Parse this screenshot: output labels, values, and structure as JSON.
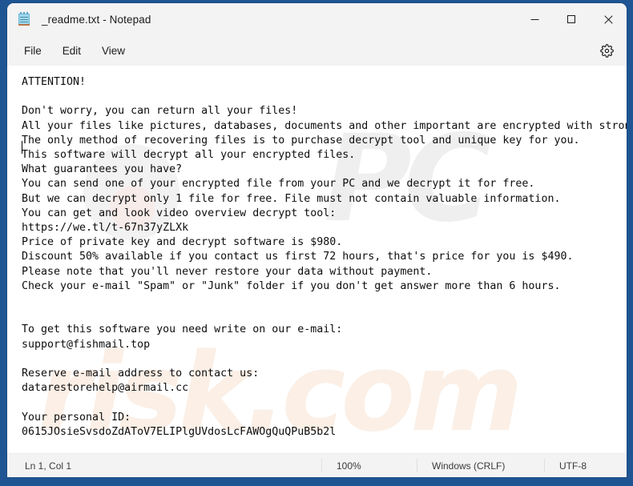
{
  "window": {
    "title": "_readme.txt - Notepad",
    "icon": "notepad-icon",
    "minimize_label": "—",
    "maximize_label": "□",
    "close_label": "✕"
  },
  "menubar": {
    "items": [
      {
        "label": "File"
      },
      {
        "label": "Edit"
      },
      {
        "label": "View"
      }
    ],
    "settings_icon": "gear-icon"
  },
  "editor": {
    "content": "ATTENTION!\n\nDon't worry, you can return all your files!\nAll your files like pictures, databases, documents and other important are encrypted with strongest encryption and unique key.\nThe only method of recovering files is to purchase decrypt tool and unique key for you.\nThis software will decrypt all your encrypted files.\nWhat guarantees you have?\nYou can send one of your encrypted file from your PC and we decrypt it for free.\nBut we can decrypt only 1 file for free. File must not contain valuable information.\nYou can get and look video overview decrypt tool:\nhttps://we.tl/t-67n37yZLXk\nPrice of private key and decrypt software is $980.\nDiscount 50% available if you contact us first 72 hours, that's price for you is $490.\nPlease note that you'll never restore your data without payment.\nCheck your e-mail \"Spam\" or \"Junk\" folder if you don't get answer more than 6 hours.\n\n\nTo get this software you need write on our e-mail:\nsupport@fishmail.top\n\nReserve e-mail address to contact us:\ndatarestorehelp@airmail.cc\n\nYour personal ID:\n0615JOsieSvsdoZdAToV7ELIPlgUVdosLcFAWOgQuQPuB5b2l"
  },
  "watermark": {
    "top_text": "PC",
    "bottom_text": "risk.com"
  },
  "statusbar": {
    "position": "Ln 1, Col 1",
    "zoom": "100%",
    "line_ending": "Windows (CRLF)",
    "encoding": "UTF-8"
  },
  "colors": {
    "desktop": "#1f5593",
    "chrome": "#f3f3f3",
    "editor_bg": "#ffffff",
    "text": "#0d0d0d",
    "close_hover": "#c42b1c"
  }
}
